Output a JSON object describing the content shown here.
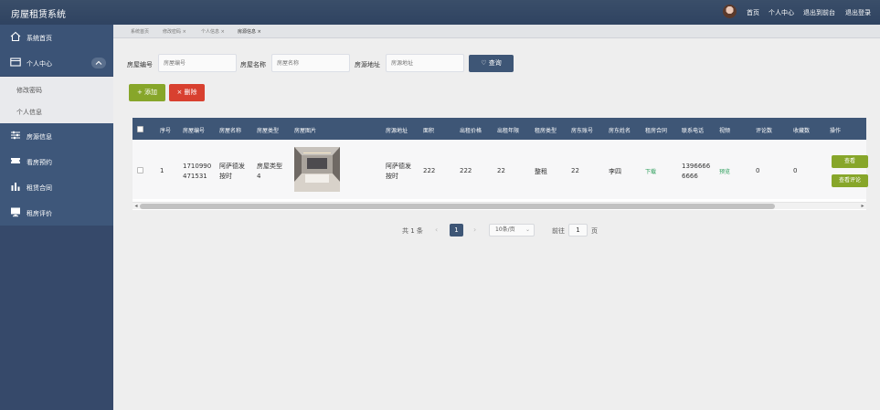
{
  "app": {
    "title": "房屋租赁系统"
  },
  "topbar": {
    "links": [
      "首页",
      "个人中心",
      "退出到前台",
      "退出登录"
    ]
  },
  "sidebar": {
    "items": [
      {
        "label": "系统首页",
        "icon": "home-icon"
      },
      {
        "label": "个人中心",
        "icon": "id-card-icon"
      },
      {
        "label": "房源信息",
        "icon": "sliders-icon"
      },
      {
        "label": "看房预约",
        "icon": "ticket-icon"
      },
      {
        "label": "租赁合同",
        "icon": "bar-chart-icon"
      },
      {
        "label": "租房评价",
        "icon": "monitor-icon"
      }
    ],
    "subitems": [
      "修改密码",
      "个人信息"
    ]
  },
  "tabs": [
    "系统首页",
    "修改密码 ×",
    "个人信息 ×",
    "房源信息 ×"
  ],
  "search": {
    "fields": [
      {
        "label": "房屋编号",
        "placeholder": "房屋编号"
      },
      {
        "label": "房屋名称",
        "placeholder": "房屋名称"
      },
      {
        "label": "房源地址",
        "placeholder": "房源地址"
      }
    ],
    "button": "♡ 查询"
  },
  "actions": {
    "add": "+ 添加",
    "delete": "× 删除"
  },
  "table": {
    "headers": [
      "序号",
      "房屋编号",
      "房屋名称",
      "房屋类型",
      "房屋图片",
      "房源地址",
      "面积",
      "出租价格",
      "出租年限",
      "租房类型",
      "房东账号",
      "房东姓名",
      "租房合同",
      "联系电话",
      "视频",
      "评论数",
      "收藏数",
      "操作"
    ],
    "rows": [
      {
        "index": "1",
        "code_line1": "1710990",
        "code_line2": "471531",
        "name_line1": "阿萨德发",
        "name_line2": "按时",
        "type_line1": "房屋类型",
        "type_line2": "4",
        "address_line1": "阿萨德发",
        "address_line2": "按时",
        "area": "222",
        "price": "222",
        "years": "22",
        "rent_type": "整租",
        "landlord_account": "22",
        "landlord_name": "李四",
        "contract": "下载",
        "phone_line1": "1396666",
        "phone_line2": "6666",
        "video": "预览",
        "comments": "0",
        "favorites": "0",
        "op_view": "查看",
        "op_review": "查看评论"
      }
    ]
  },
  "pagination": {
    "total": "共 1 条",
    "current": "1",
    "page_size": "10条/页",
    "goto_label": "前往",
    "goto_value": "1",
    "page_unit": "页"
  }
}
